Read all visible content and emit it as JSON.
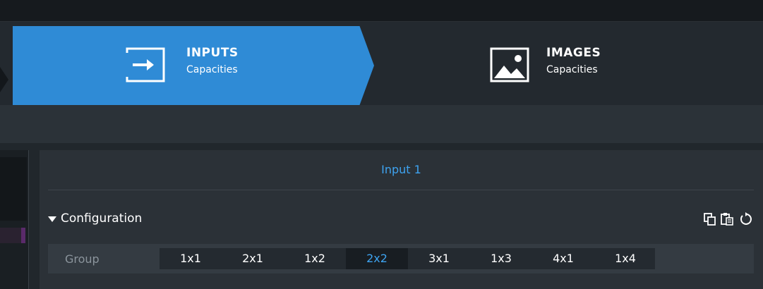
{
  "nav": {
    "tabs": [
      {
        "title": "INPUTS",
        "subtitle": "Capacities",
        "icon": "input-arrow-icon",
        "active": true
      },
      {
        "title": "IMAGES",
        "subtitle": "Capacities",
        "icon": "image-icon",
        "active": false
      }
    ]
  },
  "panel": {
    "title": "Input 1",
    "section": {
      "label": "Configuration",
      "icons": [
        "copy-icon",
        "paste-icon",
        "reset-icon"
      ]
    },
    "group": {
      "label": "Group",
      "options": [
        "1x1",
        "2x1",
        "1x2",
        "2x2",
        "3x1",
        "1x3",
        "4x1",
        "1x4"
      ],
      "selected": "2x2"
    }
  },
  "colors": {
    "accent": "#2f8bd6",
    "accent_text": "#3ea3f0",
    "background": "#1e2328"
  }
}
